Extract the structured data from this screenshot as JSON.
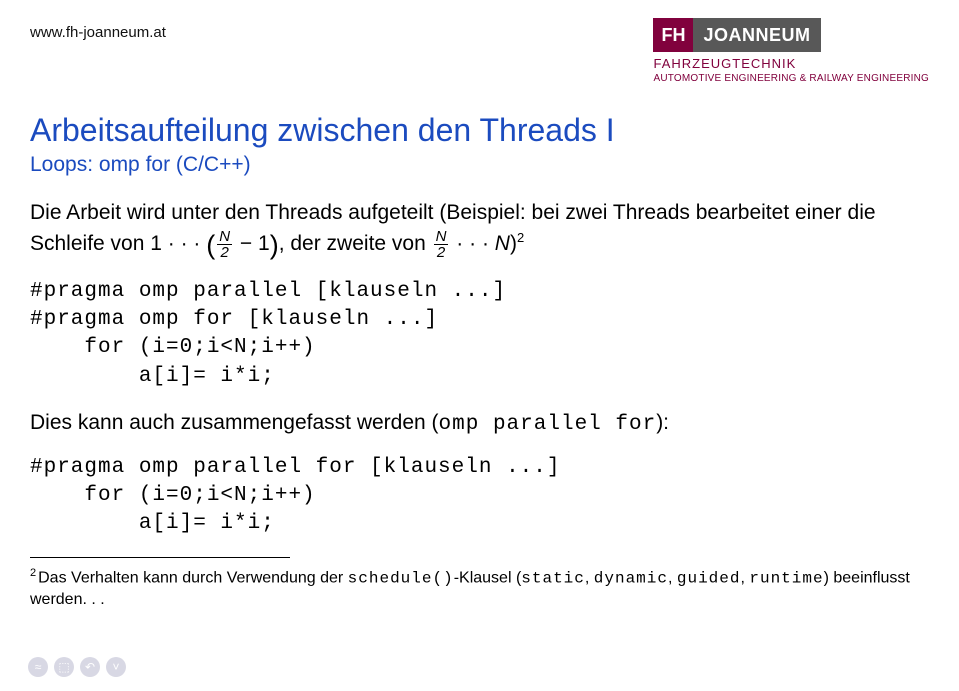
{
  "header": {
    "url": "www.fh-joanneum.at",
    "logo_fh": "FH",
    "logo_name": "JOANNEUM",
    "logo_sub1": "FAHRZEUGTECHNIK",
    "logo_sub2": "AUTOMOTIVE ENGINEERING & RAILWAY ENGINEERING"
  },
  "title": "Arbeitsaufteilung zwischen den Threads I",
  "subtitle": "Loops: omp for (C/C++)",
  "para1_a": "Die Arbeit wird unter den Threads aufgeteilt (Beispiel: bei zwei Threads bearbeitet einer die Schleife von 1 · · · ",
  "para1_b": " − 1",
  "para1_c": ", der zweite von ",
  "para1_d": " · · · ",
  "para1_e": ")",
  "frac_N": "N",
  "frac_2": "2",
  "var_N": "N",
  "sup_2": "2",
  "code1": "#pragma omp parallel [klauseln ...]\n#pragma omp for [klauseln ...]\n    for (i=0;i<N;i++)\n        a[i]= i*i;",
  "para2_a": "Dies kann auch zusammengefasst werden (",
  "para2_code": "omp parallel for",
  "para2_b": "):",
  "code2": "#pragma omp parallel for [klauseln ...]\n    for (i=0;i<N;i++)\n        a[i]= i*i;",
  "footnote_num": "2",
  "footnote_a": "Das Verhalten kann durch Verwendung der ",
  "footnote_code1": "schedule()",
  "footnote_b": "-Klausel (",
  "footnote_code2": "static",
  "footnote_c": ", ",
  "footnote_code3": "dynamic",
  "footnote_d": ", ",
  "footnote_code4": "guided",
  "footnote_e": ", ",
  "footnote_code5": "runtime",
  "footnote_f": ") beeinflusst werden. . .",
  "nav": {
    "b1": "≈",
    "b2": "⬚",
    "b3": "↶",
    "b4": "˅"
  }
}
